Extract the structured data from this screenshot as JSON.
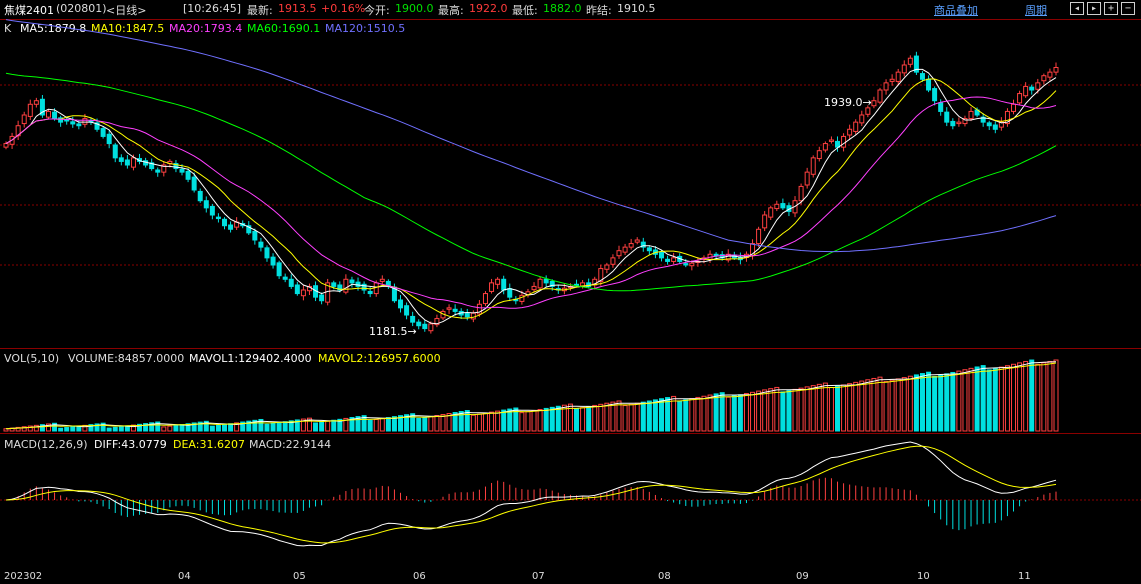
{
  "header": {
    "symbol": "焦煤2401",
    "code": "(020801)",
    "period": "<日线>",
    "time": "[10:26:45]",
    "latest_label": "最新:",
    "latest_value": "1913.5",
    "change_value": "+0.16%",
    "open_label": "今开:",
    "open_value": "1900.0",
    "high_label": "最高:",
    "high_value": "1922.0",
    "low_label": "最低:",
    "low_value": "1882.0",
    "prev_label": "昨结:",
    "prev_value": "1910.5",
    "overlay_link": "商品叠加",
    "cycle_link": "周期"
  },
  "controls": [
    "prev-icon",
    "next-icon",
    "zoom-in-icon",
    "zoom-out-icon"
  ],
  "ma_legend": {
    "k": "K",
    "ma5": "MA5:1879.8",
    "ma10": "MA10:1847.5",
    "ma20": "MA20:1793.4",
    "ma60": "MA60:1690.1",
    "ma120": "MA120:1510.5"
  },
  "annotations": {
    "high": "1939.0",
    "low": "1181.5"
  },
  "vol_legend": {
    "title": "VOL(5,10)",
    "volume": "VOLUME:84857.0000",
    "mavol1": "MAVOL1:129402.4000",
    "mavol2": "MAVOL2:126957.6000"
  },
  "macd_legend": {
    "title": "MACD(12,26,9)",
    "diff": "DIFF:43.0779",
    "dea": "DEA:31.6207",
    "macd": "MACD:22.9144"
  },
  "x_axis": [
    "202302",
    "04",
    "05",
    "06",
    "07",
    "08",
    "09",
    "10",
    "11"
  ],
  "colors": {
    "up": "#ff4040",
    "down": "#00e0e0",
    "ma5": "#ffffff",
    "ma10": "#ffff00",
    "ma20": "#ff40ff",
    "ma60": "#00ff00",
    "ma120": "#7070ff",
    "grid": "#8a0000"
  },
  "chart_data": {
    "type": "candlestick",
    "price_range": [
      1150,
      1990
    ],
    "close": [
      1700,
      1720,
      1750,
      1780,
      1810,
      1820,
      1780,
      1790,
      1770,
      1760,
      1765,
      1755,
      1750,
      1770,
      1760,
      1740,
      1720,
      1700,
      1660,
      1650,
      1640,
      1660,
      1650,
      1640,
      1630,
      1620,
      1640,
      1650,
      1630,
      1620,
      1600,
      1570,
      1540,
      1520,
      1500,
      1490,
      1470,
      1460,
      1480,
      1470,
      1450,
      1430,
      1410,
      1380,
      1360,
      1330,
      1320,
      1300,
      1280,
      1290,
      1300,
      1270,
      1260,
      1310,
      1300,
      1290,
      1320,
      1310,
      1300,
      1290,
      1280,
      1310,
      1320,
      1300,
      1260,
      1240,
      1220,
      1200,
      1190,
      1182,
      1195,
      1210,
      1230,
      1240,
      1230,
      1220,
      1215,
      1225,
      1250,
      1280,
      1310,
      1320,
      1290,
      1270,
      1260,
      1275,
      1285,
      1300,
      1320,
      1310,
      1300,
      1290,
      1295,
      1300,
      1305,
      1310,
      1300,
      1320,
      1350,
      1360,
      1380,
      1400,
      1410,
      1420,
      1430,
      1410,
      1400,
      1390,
      1380,
      1370,
      1380,
      1370,
      1360,
      1365,
      1370,
      1380,
      1390,
      1385,
      1380,
      1390,
      1380,
      1375,
      1390,
      1420,
      1460,
      1500,
      1520,
      1530,
      1520,
      1510,
      1540,
      1580,
      1620,
      1660,
      1680,
      1700,
      1710,
      1690,
      1720,
      1740,
      1760,
      1780,
      1800,
      1820,
      1850,
      1870,
      1880,
      1900,
      1920,
      1939,
      1900,
      1880,
      1850,
      1820,
      1790,
      1760,
      1750,
      1760,
      1770,
      1790,
      1780,
      1760,
      1750,
      1740,
      1760,
      1790,
      1810,
      1840,
      1860,
      1850,
      1870,
      1890,
      1900,
      1913
    ],
    "volume_last": 84857,
    "ma": {
      "MA5": 1879.8,
      "MA10": 1847.5,
      "MA20": 1793.4,
      "MA60": 1690.1,
      "MA120": 1510.5
    },
    "macd": {
      "DIFF": 43.0779,
      "DEA": 31.6207,
      "MACD": 22.9144
    },
    "vol": {
      "VOLUME": 84857.0,
      "MAVOL1": 129402.4,
      "MAVOL2": 126957.6
    }
  }
}
